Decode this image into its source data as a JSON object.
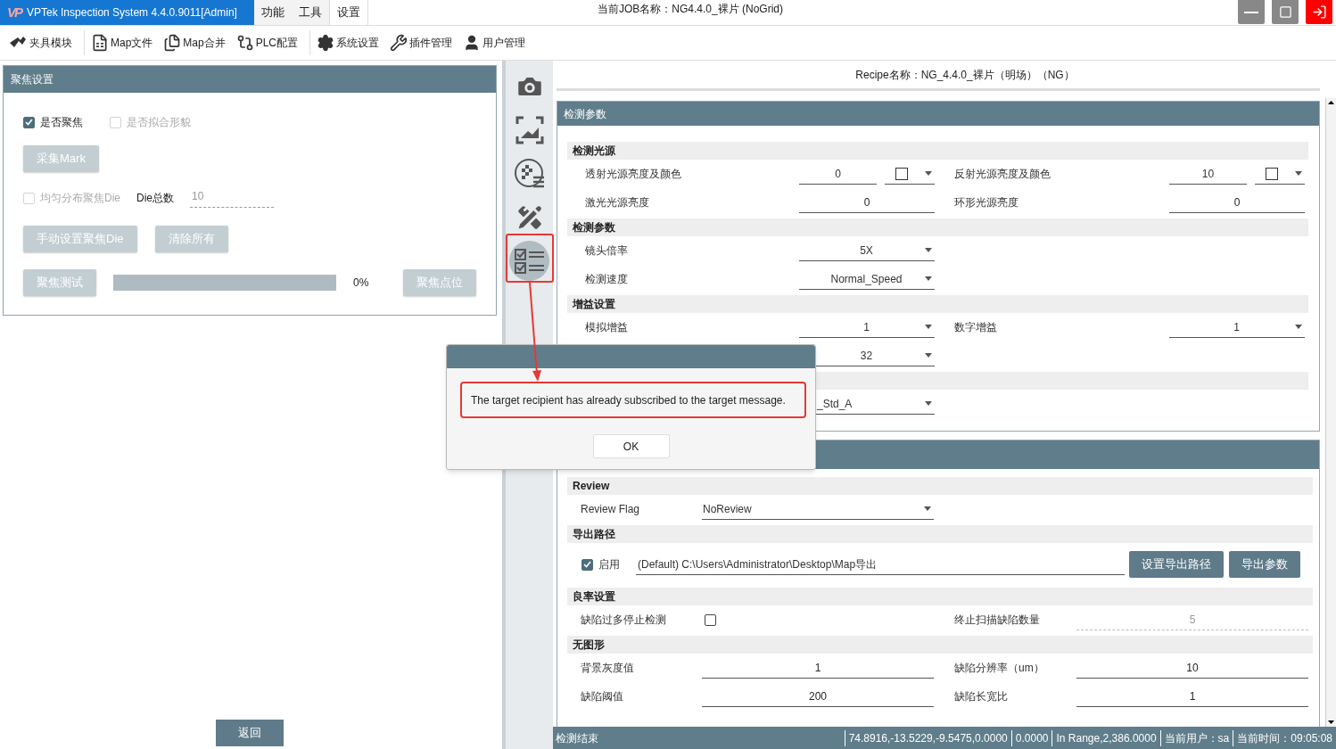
{
  "window": {
    "logo": "VP",
    "title": "VPTek Inspection System 4.4.0.9011[Admin]",
    "job": "当前JOB名称：NG4.4.0_裸片 (NoGrid)"
  },
  "menu_tabs": [
    {
      "label": "功能",
      "selected": false
    },
    {
      "label": "工具",
      "selected": false
    },
    {
      "label": "设置",
      "selected": true
    }
  ],
  "toolbar": [
    {
      "kind": "fixture",
      "label": "夹具模块"
    },
    {
      "kind": "file",
      "label": "Map文件"
    },
    {
      "kind": "merge",
      "label": "Map合并"
    },
    {
      "kind": "plc",
      "label": "PLC配置"
    },
    {
      "kind": "gear",
      "label": "系统设置"
    },
    {
      "kind": "tools",
      "label": "插件管理"
    },
    {
      "kind": "user",
      "label": "用户管理"
    }
  ],
  "focus_panel": {
    "title": "聚焦设置",
    "checkboxes": [
      {
        "label": "是否聚焦",
        "checked": true,
        "disabled": false
      },
      {
        "label": "是否拟合形貌",
        "checked": false,
        "disabled": true
      }
    ],
    "mark_button": {
      "label": "采集Mark",
      "disabled": true
    },
    "distribute": {
      "label": "均匀分布聚焦Die",
      "checked": false,
      "disabled": true
    },
    "die_count": {
      "label": "Die总数",
      "value": "10"
    },
    "buttons": [
      {
        "label": "手动设置聚焦Die",
        "disabled": true
      },
      {
        "label": "清除所有",
        "disabled": true
      }
    ],
    "test_button": {
      "label": "聚焦测试",
      "disabled": true
    },
    "progress": {
      "level": 0,
      "reading": "0%"
    },
    "point_button": {
      "label": "聚焦点位",
      "disabled": true
    }
  },
  "return_button": "返回",
  "side_icons": [
    {
      "kind": "camera",
      "selected": false
    },
    {
      "kind": "frame",
      "selected": false
    },
    {
      "kind": "grid",
      "selected": false
    },
    {
      "kind": "ruler",
      "selected": false
    },
    {
      "kind": "checklist",
      "selected": true
    }
  ],
  "recipe_title": "Recipe名称：NG_4.4.0_裸片（明场）（NG）",
  "section_1": {
    "title": "检测参数",
    "rows": [
      {
        "kind": "subheader",
        "label": "检测光源"
      },
      {
        "kind": "row",
        "label": "透射光源亮度及颜色",
        "field": {
          "kind": "color-input",
          "value": "0",
          "color": "#ffffff"
        },
        "label2": "反射光源亮度及颜色",
        "field2": {
          "kind": "color-input",
          "value": "10",
          "color": "#ffffff"
        }
      },
      {
        "kind": "row",
        "label": "激光光源亮度",
        "field": {
          "kind": "input",
          "value": "0"
        },
        "label2": "环形光源亮度",
        "field2": {
          "kind": "input",
          "value": "0"
        }
      },
      {
        "kind": "subheader",
        "label": "检测参数"
      },
      {
        "kind": "row",
        "label": "镜头倍率",
        "field": {
          "kind": "dropdown",
          "value": "5X"
        }
      },
      {
        "kind": "row",
        "label": "检测速度",
        "field": {
          "kind": "dropdown",
          "value": "Normal_Speed"
        }
      },
      {
        "kind": "subheader",
        "label": "增益设置"
      },
      {
        "kind": "row",
        "label": "模拟增益",
        "field": {
          "kind": "dropdown",
          "value": "1"
        },
        "label2": "数字增益",
        "field2": {
          "kind": "dropdown",
          "value": "1"
        }
      },
      {
        "kind": "row",
        "field": {
          "kind": "dropdown",
          "value": "32"
        }
      },
      {
        "kind": "subheader"
      },
      {
        "kind": "row",
        "field": {
          "kind": "dropdown-cut",
          "value": "_Std_A"
        }
      }
    ]
  },
  "section_2": {
    "rows": [
      {
        "kind": "subheader",
        "label": "Review"
      },
      {
        "kind": "row",
        "label": "Review Flag",
        "field": {
          "kind": "dropdown-left",
          "value": "NoReview"
        }
      },
      {
        "kind": "subheader",
        "label": "导出路径"
      },
      {
        "kind": "export",
        "checked": true,
        "label": "启用",
        "path": "(Default) C:\\Users\\Administrator\\Desktop\\Map导出",
        "buttons": [
          "设置导出路径",
          "导出参数"
        ]
      },
      {
        "kind": "subheader",
        "label": "良率设置"
      },
      {
        "kind": "row",
        "label": "缺陷过多停止检测",
        "field": {
          "kind": "checkbox",
          "checked": false
        },
        "label2": "终止扫描缺陷数量",
        "field2": {
          "kind": "input",
          "value": "5",
          "disabled": true
        }
      },
      {
        "kind": "subheader",
        "label": "无图形"
      },
      {
        "kind": "row",
        "label": "背景灰度值",
        "field": {
          "kind": "input",
          "value": "1"
        },
        "label2": "缺陷分辨率（um）",
        "field2": {
          "kind": "input",
          "value": "10"
        }
      },
      {
        "kind": "row",
        "label": "缺陷阈值",
        "field": {
          "kind": "input",
          "value": "200"
        },
        "label2": "缺陷长宽比",
        "field2": {
          "kind": "input",
          "value": "1"
        }
      }
    ]
  },
  "dialog": {
    "message": "The target recipient has already subscribed to the target message.",
    "button": "OK"
  },
  "status_bar": {
    "left": "检测结束",
    "items": [
      "74.8916,-13.5229,-9.5475,0.0000",
      "0.0000",
      "In Range,2,386.0000",
      "当前用户：sa",
      "当前时间：09:05:08"
    ]
  }
}
